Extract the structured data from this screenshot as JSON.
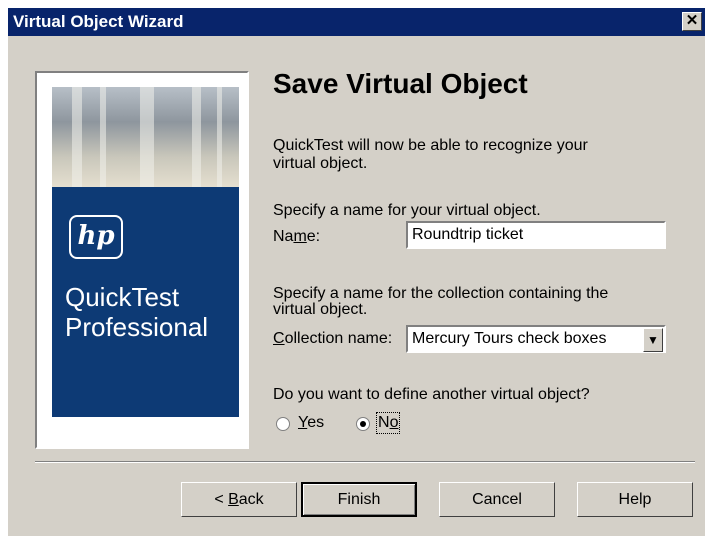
{
  "window": {
    "title": "Virtual Object Wizard",
    "close_glyph": "✕"
  },
  "sidebar": {
    "logo_text": "hp",
    "product_line1": "QuickTest",
    "product_line2": "Professional"
  },
  "main": {
    "heading": "Save Virtual Object",
    "intro_line1": "QuickTest will now be able to recognize your",
    "intro_line2": "virtual object.",
    "name_prompt": "Specify a name for your virtual object.",
    "name_label_pre": "Na",
    "name_label_mn": "m",
    "name_label_post": "e:",
    "name_value": "Roundtrip ticket",
    "collection_prompt_line1": "Specify a name for the collection containing the",
    "collection_prompt_line2": "virtual object.",
    "collection_label_mn": "C",
    "collection_label_rest": "ollection name:",
    "collection_value": "Mercury Tours check boxes",
    "collection_arrow": "▼",
    "another_prompt": "Do you want to define another virtual object?",
    "yes_mn": "Y",
    "yes_rest": "es",
    "no_pre": "N",
    "no_mn": "o",
    "selected_option": "No"
  },
  "buttons": {
    "back_pre": "< ",
    "back_mn": "B",
    "back_rest": "ack",
    "finish": "Finish",
    "cancel": "Cancel",
    "help": "Help"
  }
}
